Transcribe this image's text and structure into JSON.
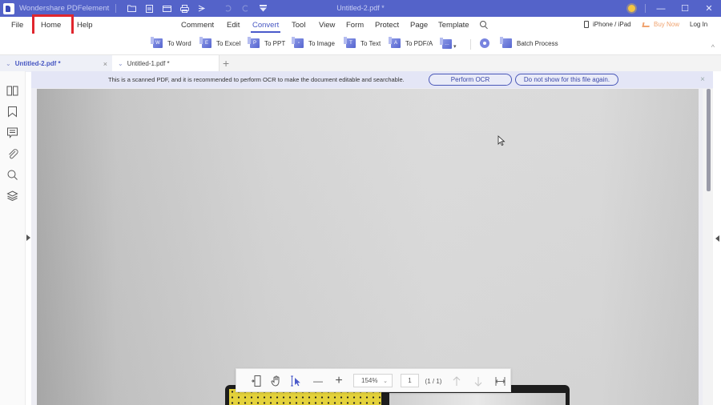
{
  "titlebar": {
    "app_name": "Wondershare PDFelement",
    "document_title": "Untitled-2.pdf *",
    "quick_actions": [
      "open-folder-icon",
      "save-icon",
      "email-icon",
      "print-icon",
      "share-icon",
      "undo-icon",
      "redo-icon",
      "customize-dropdown-icon"
    ],
    "window_controls": {
      "minimize": "—",
      "maximize": "☐",
      "close": "✕"
    }
  },
  "menubar": {
    "left": [
      "File",
      "Home",
      "Help"
    ],
    "center": [
      "Comment",
      "Edit",
      "Convert",
      "Tool",
      "View",
      "Form",
      "Protect",
      "Page",
      "Template"
    ],
    "active": "Convert",
    "highlighted": "Home",
    "right": {
      "device": "iPhone / iPad",
      "buy": "Buy Now",
      "login": "Log In"
    }
  },
  "toolbar": {
    "buttons": [
      {
        "label": "To Word",
        "letter": "W"
      },
      {
        "label": "To Excel",
        "letter": "E"
      },
      {
        "label": "To PPT",
        "letter": "P"
      },
      {
        "label": "To Image",
        "letter": "▫"
      },
      {
        "label": "To Text",
        "letter": "T"
      },
      {
        "label": "To PDF/A",
        "letter": "A"
      }
    ],
    "more_label": "…",
    "batch_label": "Batch Process",
    "collapse": "^"
  },
  "tabs": [
    {
      "label": "Untitled-2.pdf *",
      "active": true
    },
    {
      "label": "Untitled-1.pdf *",
      "active": false
    }
  ],
  "tab_add": "+",
  "tab_close": "×",
  "sidebar": {
    "items": [
      "thumbnails-icon",
      "bookmark-icon",
      "comment-icon",
      "attachment-icon",
      "search-icon",
      "layers-icon"
    ]
  },
  "ocr_banner": {
    "message": "This is a scanned PDF, and it is recommended to perform OCR to make the document editable and searchable.",
    "perform_label": "Perform OCR",
    "dismiss_label": "Do not show for this file again.",
    "close": "×"
  },
  "bottom_toolbar": {
    "zoom": "154%",
    "page_input": "1",
    "page_count": "(1 / 1)",
    "minus": "—",
    "plus": "+"
  }
}
